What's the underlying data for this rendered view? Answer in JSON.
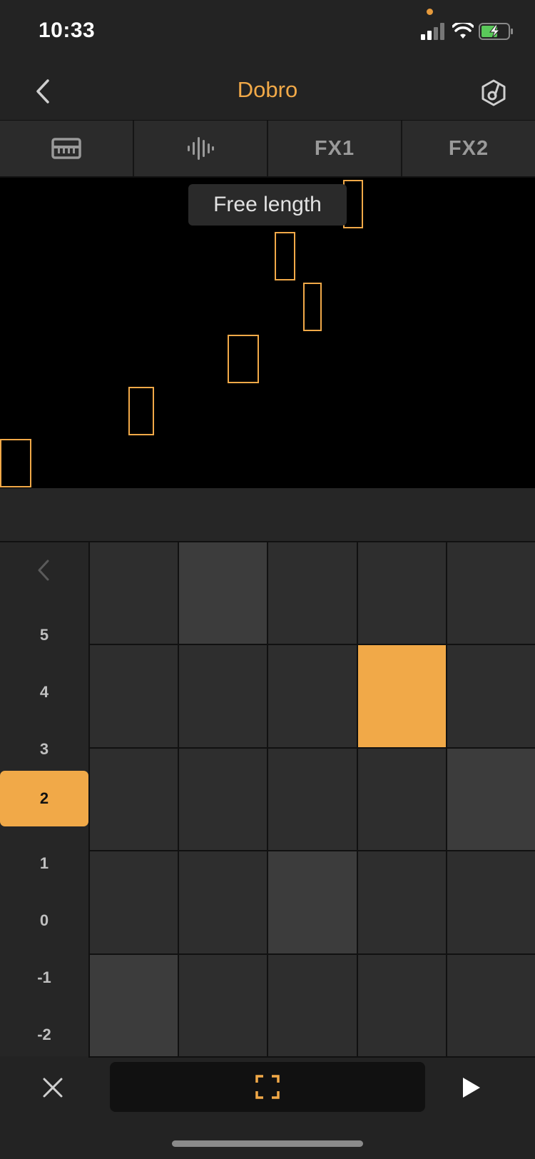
{
  "status_bar": {
    "time": "10:33",
    "icons": [
      "cellular-signal-icon",
      "wifi-icon",
      "battery-charging-icon"
    ]
  },
  "nav": {
    "title": "Dobro",
    "back_icon": "chevron-left-icon",
    "right_icon": "instrument-settings-icon"
  },
  "tabs": [
    {
      "label": "",
      "icon": "keyboard-icon"
    },
    {
      "label": "",
      "icon": "waveform-icon"
    },
    {
      "label": "FX1"
    },
    {
      "label": "FX2"
    }
  ],
  "piano_roll": {
    "tooltip": "Free length"
  },
  "octave_labels": [
    "5",
    "4",
    "3",
    "2",
    "1",
    "0",
    "-1",
    "-2"
  ],
  "selected_octave": "2",
  "pad_grid": {
    "rows": 5,
    "cols": 5,
    "lit_pad": {
      "row": 2,
      "col": 4
    },
    "light_pads": [
      [
        1,
        2
      ],
      [
        3,
        5
      ],
      [
        4,
        3
      ],
      [
        5,
        1
      ]
    ]
  },
  "bottom_toolbar": {
    "icons": [
      "close-icon",
      "fullscreen-icon",
      "play-icon"
    ]
  },
  "colors": {
    "accent": "#f1a948",
    "background": "#232323",
    "pad": "#2e2e2e",
    "pad_light": "#3c3c3c"
  }
}
